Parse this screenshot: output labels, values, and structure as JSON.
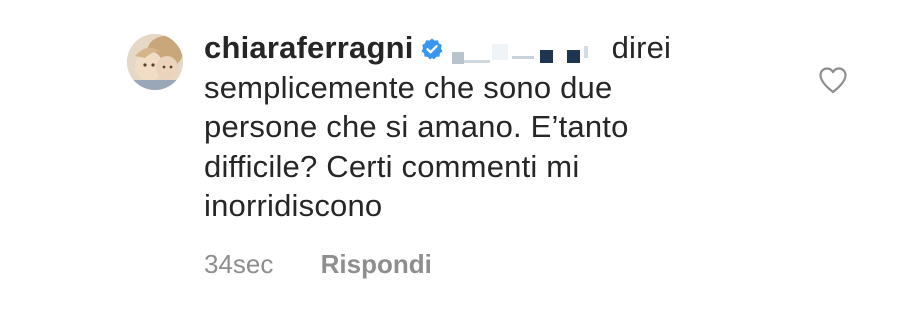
{
  "comment": {
    "username": "chiaraferragni",
    "verified": true,
    "text_lines": [
      "direi",
      "semplicemente che sono due",
      "persone che si amano. E’tanto",
      "difficile? Certi commenti mi",
      "inorridiscono"
    ],
    "timestamp": "34sec",
    "reply_label": "Rispondi"
  },
  "colors": {
    "text": "#262626",
    "meta": "#8e8e8e",
    "verified_badge": "#3897f0"
  },
  "icons": {
    "verified": "verified-badge-icon",
    "like": "heart-outline-icon"
  }
}
